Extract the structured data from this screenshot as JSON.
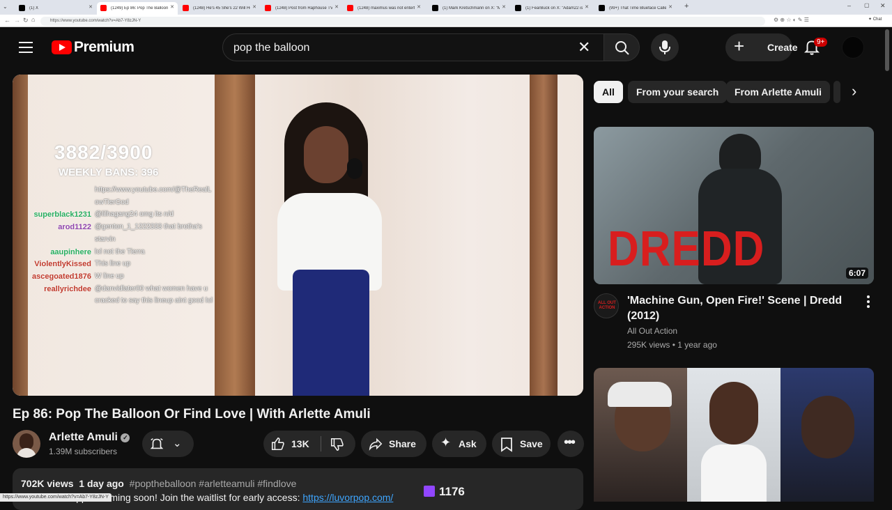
{
  "browser": {
    "tabs": [
      {
        "title": "(1) X",
        "color": "#000000"
      },
      {
        "title": "(1249) Ep 86: Pop The Balloon Or",
        "color": "#ff0000"
      },
      {
        "title": "(1248) He's 45 She's 22 Will He Ch",
        "color": "#ff0000"
      },
      {
        "title": "(1248) Post from Raphouse TV - Yo",
        "color": "#ff0000"
      },
      {
        "title": "(1248) maximus was not entertaini",
        "color": "#ff0000"
      },
      {
        "title": "(1) Mark Kretschmann on X: \"Mar",
        "color": "#000000"
      },
      {
        "title": "(1) FearBuck on X: \"Adam22 is set",
        "color": "#000000"
      },
      {
        "title": "(99+) That Time Blueface Called O",
        "color": "#000000"
      }
    ],
    "url": "https://www.youtube.com/watch?v=Ab7-Y8zJN-Y",
    "chat_label": "Chat",
    "status_url": "https://www.youtube.com/watch?v=Ab7-Y8zJN-Y"
  },
  "header": {
    "logo_text": "Premium",
    "search_value": "pop the balloon",
    "create_label": "Create",
    "notification_badge": "9+"
  },
  "video": {
    "overlay": {
      "counter": "3882/3900",
      "weekly_bans": "WEEKLY BANS: 396",
      "chat": [
        {
          "user": "",
          "user_color": "#ffffff",
          "message": "https://www.youtube.com/@TheRealL"
        },
        {
          "user": "",
          "user_color": "#ffffff",
          "message": "owTierGod"
        },
        {
          "user": "superblack1231",
          "user_color": "#27ae60",
          "message": "@lilhagang24 omg its n/d"
        },
        {
          "user": "arod1122",
          "user_color": "#8e44ad",
          "message": "@genton_1_1222333 that brotha's"
        },
        {
          "user": "",
          "user_color": "#ffffff",
          "message": "starvin"
        },
        {
          "user": "aaupinhere",
          "user_color": "#27ae60",
          "message": "lol not the Tierra"
        },
        {
          "user": "ViolentlyKissed",
          "user_color": "#c0392b",
          "message": "This line up"
        },
        {
          "user": "ascegoated1876",
          "user_color": "#c0392b",
          "message": "W line up"
        },
        {
          "user": "reallyrichdee",
          "user_color": "#c0392b",
          "message": "@danvidlater00 what women have u"
        },
        {
          "user": "",
          "user_color": "#ffffff",
          "message": "cracked to say this lineup aint good lol"
        }
      ]
    },
    "title": "Ep 86: Pop The Balloon Or Find Love | With Arlette Amuli",
    "channel": {
      "name": "Arlette Amuli",
      "subscribers": "1.39M subscribers"
    },
    "actions": {
      "likes": "13K",
      "share": "Share",
      "ask": "Ask",
      "save": "Save"
    },
    "description": {
      "views": "702K views",
      "date": "1 day ago",
      "tags": "#poptheballoon #arletteamuli #findlove",
      "line2_prefix": "Our official App is coming soon! Join the waitlist for early access:",
      "line2_link": "https://luvorpop.com/",
      "twitch_count": "1176"
    }
  },
  "sidebar": {
    "chips": [
      "All",
      "From your search",
      "From Arlette Amuli"
    ],
    "videos": [
      {
        "thumb_text": "DREDD",
        "duration": "6:07",
        "title": "'Machine Gun, Open Fire!' Scene | Dredd (2012)",
        "channel": "All Out Action",
        "views": "295K views",
        "age": "1 year ago",
        "avatar_text": "ALL OUT ACTION"
      }
    ]
  },
  "colors": {
    "youtube_red": "#ff0000",
    "background": "#0f0f0f",
    "chip_bg": "#272727",
    "link_blue": "#3ea6ff",
    "twitch_purple": "#9146ff"
  }
}
